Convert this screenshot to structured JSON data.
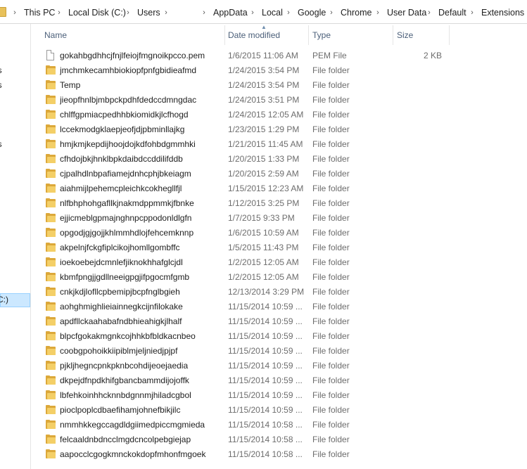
{
  "breadcrumbs": [
    "This PC",
    "Local Disk (C:)",
    "Users",
    "",
    "AppData",
    "Local",
    "Google",
    "Chrome",
    "User Data",
    "Default",
    "Extensions"
  ],
  "nav_fragments": [
    "ls",
    "ls",
    "es",
    "C:)"
  ],
  "columns": {
    "name": "Name",
    "date": "Date modified",
    "type": "Type",
    "size": "Size"
  },
  "files": [
    {
      "name": "gokahbgdhhcjfnjlfeiojfmgnoikpcco.pem",
      "date": "1/6/2015 11:06 AM",
      "type": "PEM File",
      "size": "2 KB",
      "icon": "file-icon"
    },
    {
      "name": "jmchmkecamhbiokiopfpnfgbidieafmd",
      "date": "1/24/2015 3:54 PM",
      "type": "File folder",
      "size": "",
      "icon": "folder-icon"
    },
    {
      "name": "Temp",
      "date": "1/24/2015 3:54 PM",
      "type": "File folder",
      "size": "",
      "icon": "folder-icon"
    },
    {
      "name": "jieopfhnlbjmbpckpdhfdedccdmngdac",
      "date": "1/24/2015 3:51 PM",
      "type": "File folder",
      "size": "",
      "icon": "folder-icon"
    },
    {
      "name": "chlffgpmiacpedhhbkiomidkjlcfhogd",
      "date": "1/24/2015 12:05 AM",
      "type": "File folder",
      "size": "",
      "icon": "folder-icon"
    },
    {
      "name": "lccekmodgklaepjeofjdjpbminllajkg",
      "date": "1/23/2015 1:29 PM",
      "type": "File folder",
      "size": "",
      "icon": "folder-icon"
    },
    {
      "name": "hmjkmjkepdijhoojdojkdfohbdgmmhki",
      "date": "1/21/2015 11:45 AM",
      "type": "File folder",
      "size": "",
      "icon": "folder-icon"
    },
    {
      "name": "cfhdojbkjhnklbpkdaibdccddilifddb",
      "date": "1/20/2015 1:33 PM",
      "type": "File folder",
      "size": "",
      "icon": "folder-icon"
    },
    {
      "name": "cjpalhdlnbpafiamejdnhcphjbkeiagm",
      "date": "1/20/2015 2:59 AM",
      "type": "File folder",
      "size": "",
      "icon": "folder-icon"
    },
    {
      "name": "aiahmijlpehemcpleichkcokhegllfjl",
      "date": "1/15/2015 12:23 AM",
      "type": "File folder",
      "size": "",
      "icon": "folder-icon"
    },
    {
      "name": "nlfbhphohgafllkjnakmdppmmkjfbnke",
      "date": "1/12/2015 3:25 PM",
      "type": "File folder",
      "size": "",
      "icon": "folder-icon"
    },
    {
      "name": "ejjicmeblgpmajnghnpcppodonldlgfn",
      "date": "1/7/2015 9:33 PM",
      "type": "File folder",
      "size": "",
      "icon": "folder-icon"
    },
    {
      "name": "opgodjgjgojjkhlmmhdlojfehcemknnp",
      "date": "1/6/2015 10:59 AM",
      "type": "File folder",
      "size": "",
      "icon": "folder-icon"
    },
    {
      "name": "akpelnjfckgfiplcikojhomllgombffc",
      "date": "1/5/2015 11:43 PM",
      "type": "File folder",
      "size": "",
      "icon": "folder-icon"
    },
    {
      "name": "ioekoebejdcmnlefjiknokhhafglcjdl",
      "date": "1/2/2015 12:05 AM",
      "type": "File folder",
      "size": "",
      "icon": "folder-icon"
    },
    {
      "name": "kbmfpngjjgdllneeigpgjifpgocmfgmb",
      "date": "1/2/2015 12:05 AM",
      "type": "File folder",
      "size": "",
      "icon": "folder-icon"
    },
    {
      "name": "cnkjkdjlofllcpbemipjbcpfnglbgieh",
      "date": "12/13/2014 3:29 PM",
      "type": "File folder",
      "size": "",
      "icon": "folder-icon"
    },
    {
      "name": "aohghmighlieiainnegkcijnfilokake",
      "date": "11/15/2014 10:59 ...",
      "type": "File folder",
      "size": "",
      "icon": "folder-icon"
    },
    {
      "name": "apdfllckaahabafndbhieahigkjlhalf",
      "date": "11/15/2014 10:59 ...",
      "type": "File folder",
      "size": "",
      "icon": "folder-icon"
    },
    {
      "name": "blpcfgokakmgnkcojhhkbfbldkacnbeo",
      "date": "11/15/2014 10:59 ...",
      "type": "File folder",
      "size": "",
      "icon": "folder-icon"
    },
    {
      "name": "coobgpohoikkiipiblmjeljniedjpjpf",
      "date": "11/15/2014 10:59 ...",
      "type": "File folder",
      "size": "",
      "icon": "folder-icon"
    },
    {
      "name": "pjkljhegncpnkpknbcohdijeoejaedia",
      "date": "11/15/2014 10:59 ...",
      "type": "File folder",
      "size": "",
      "icon": "folder-icon"
    },
    {
      "name": "dkpejdfnpdkhifgbancbammdijojoffk",
      "date": "11/15/2014 10:59 ...",
      "type": "File folder",
      "size": "",
      "icon": "folder-icon"
    },
    {
      "name": "lbfehkoinhhcknnbdgnnmjhiladcgbol",
      "date": "11/15/2014 10:59 ...",
      "type": "File folder",
      "size": "",
      "icon": "folder-icon"
    },
    {
      "name": "pioclpoplcdbaefihamjohnefbikjilc",
      "date": "11/15/2014 10:59 ...",
      "type": "File folder",
      "size": "",
      "icon": "folder-icon"
    },
    {
      "name": "nmmhkkegccagdldgiimedpiccmgmieda",
      "date": "11/15/2014 10:58 ...",
      "type": "File folder",
      "size": "",
      "icon": "folder-icon"
    },
    {
      "name": "felcaaldnbdncclmgdcncolpebgiejap",
      "date": "11/15/2014 10:58 ...",
      "type": "File folder",
      "size": "",
      "icon": "folder-icon"
    },
    {
      "name": "aapocclcgogkmnckokdopfmhonfmgoek",
      "date": "11/15/2014 10:58 ...",
      "type": "File folder",
      "size": "",
      "icon": "folder-icon"
    }
  ]
}
